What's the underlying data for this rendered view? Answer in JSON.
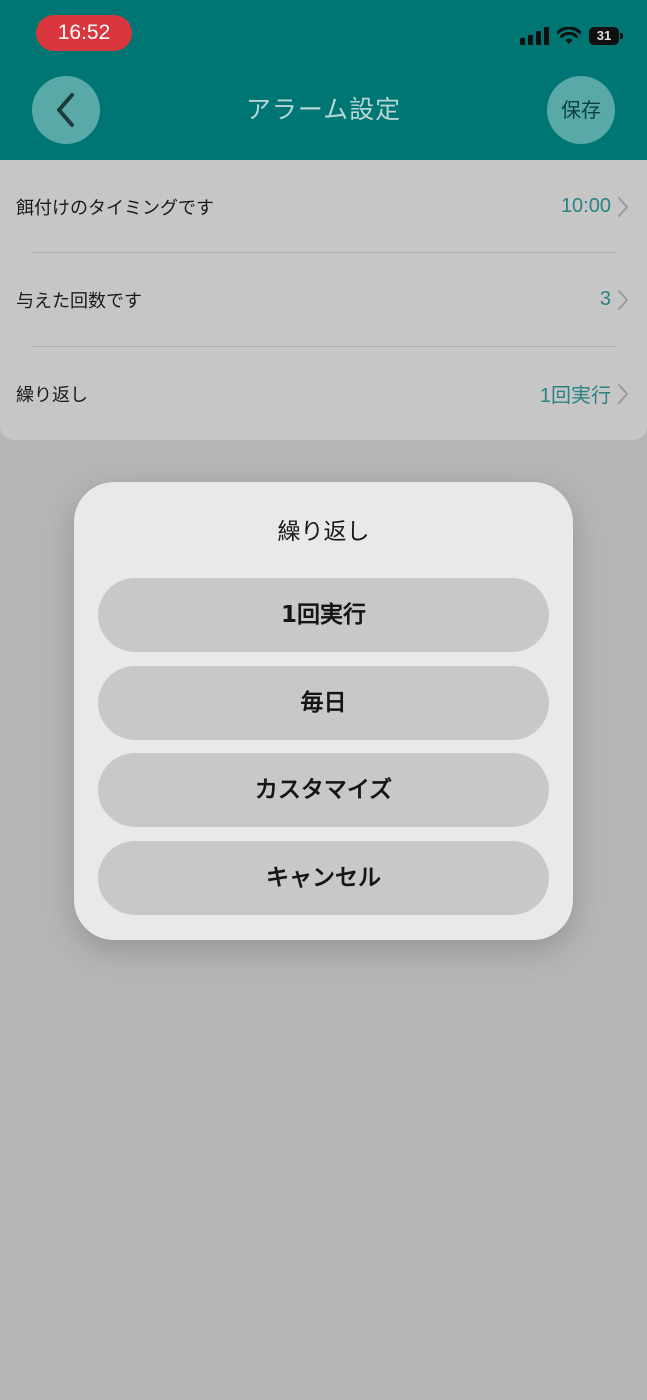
{
  "status_bar": {
    "time": "16:52",
    "battery": "31",
    "icons": [
      "signal-icon",
      "wifi-icon",
      "battery-icon"
    ]
  },
  "header": {
    "title": "アラーム設定",
    "back_icon": "chevron-left-icon",
    "save_label": "保存"
  },
  "settings": {
    "rows": [
      {
        "label": "餌付けのタイミングです",
        "value": "10:00"
      },
      {
        "label": "与えた回数です",
        "value": "3"
      },
      {
        "label": "繰り返し",
        "value": "1回実行"
      }
    ]
  },
  "dialog": {
    "title": "繰り返し",
    "options": [
      {
        "label": "1回実行"
      },
      {
        "label": "毎日"
      },
      {
        "label": "カスタマイズ"
      },
      {
        "label": "キャンセル"
      }
    ]
  },
  "colors": {
    "header_teal": "#007674",
    "value_teal": "#2b8282",
    "status_time_bg": "#d9363e",
    "overlay": "#b5b5b5"
  }
}
